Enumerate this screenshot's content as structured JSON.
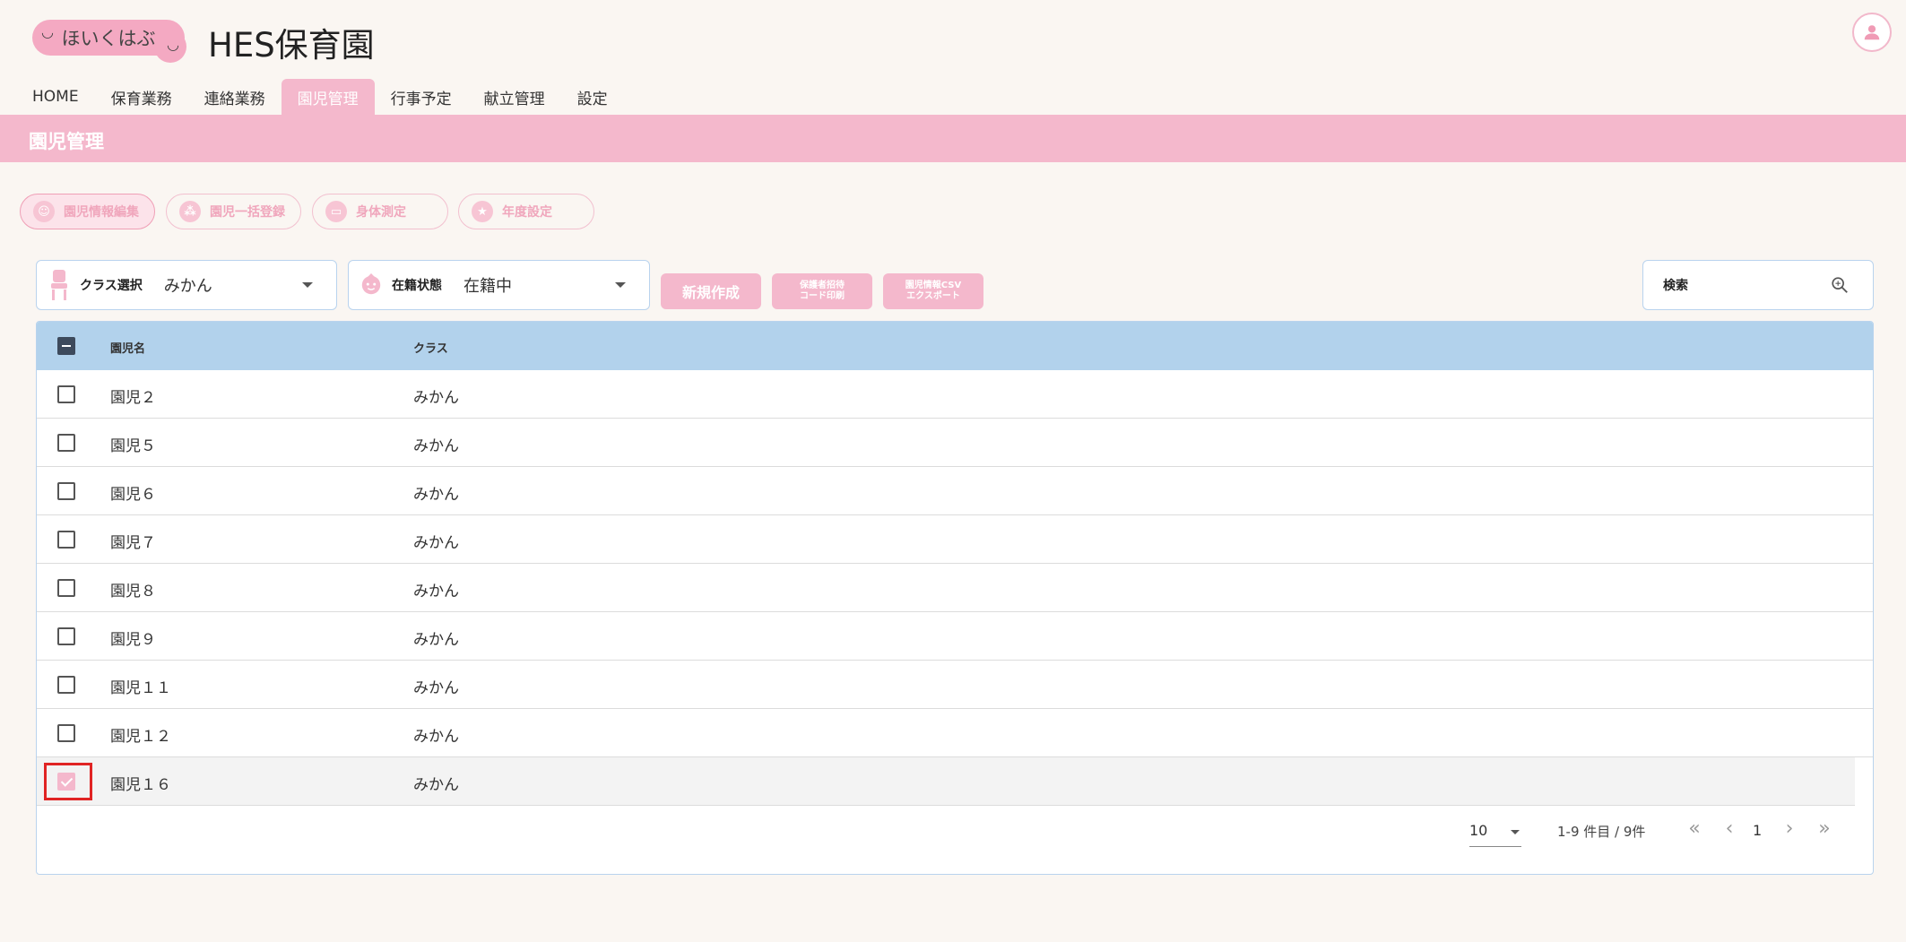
{
  "header": {
    "logo_text": "ほいくはぶ",
    "title": "HES保育園"
  },
  "nav": {
    "tabs": [
      {
        "label": "HOME",
        "active": false
      },
      {
        "label": "保育業務",
        "active": false
      },
      {
        "label": "連絡業務",
        "active": false
      },
      {
        "label": "園児管理",
        "active": true
      },
      {
        "label": "行事予定",
        "active": false
      },
      {
        "label": "献立管理",
        "active": false
      },
      {
        "label": "設定",
        "active": false
      }
    ]
  },
  "page": {
    "title": "園児管理"
  },
  "actions": [
    {
      "label": "園児情報編集",
      "active": true
    },
    {
      "label": "園児一括登録",
      "active": false
    },
    {
      "label": "身体測定",
      "active": false
    },
    {
      "label": "年度設定",
      "active": false
    }
  ],
  "filters": {
    "class": {
      "label": "クラス選択",
      "value": "みかん"
    },
    "status": {
      "label": "在籍状態",
      "value": "在籍中"
    }
  },
  "buttons": {
    "new": "新規作成",
    "invite_line1": "保護者招待",
    "invite_line2": "コード印刷",
    "export_line1": "園児情報CSV",
    "export_line2": "エクスポート"
  },
  "search": {
    "label": "検索"
  },
  "table": {
    "headers": {
      "name": "園児名",
      "class": "クラス"
    },
    "rows": [
      {
        "name": "園児２",
        "class": "みかん",
        "checked": false
      },
      {
        "name": "園児５",
        "class": "みかん",
        "checked": false
      },
      {
        "name": "園児６",
        "class": "みかん",
        "checked": false
      },
      {
        "name": "園児７",
        "class": "みかん",
        "checked": false
      },
      {
        "name": "園児８",
        "class": "みかん",
        "checked": false
      },
      {
        "name": "園児９",
        "class": "みかん",
        "checked": false
      },
      {
        "name": "園児１１",
        "class": "みかん",
        "checked": false
      },
      {
        "name": "園児１２",
        "class": "みかん",
        "checked": false
      },
      {
        "name": "園児１６",
        "class": "みかん",
        "checked": true
      }
    ]
  },
  "pagination": {
    "per_page": "10",
    "range": "1-9 件目 / 9件",
    "current_page": "1",
    "first": "«",
    "prev": "‹",
    "next": "›",
    "last": "»"
  },
  "colors": {
    "accent_pink": "#f4b8cc",
    "header_blue": "#b2d2ec",
    "border_blue": "#b9d3ee",
    "focus_red": "#e02424"
  }
}
